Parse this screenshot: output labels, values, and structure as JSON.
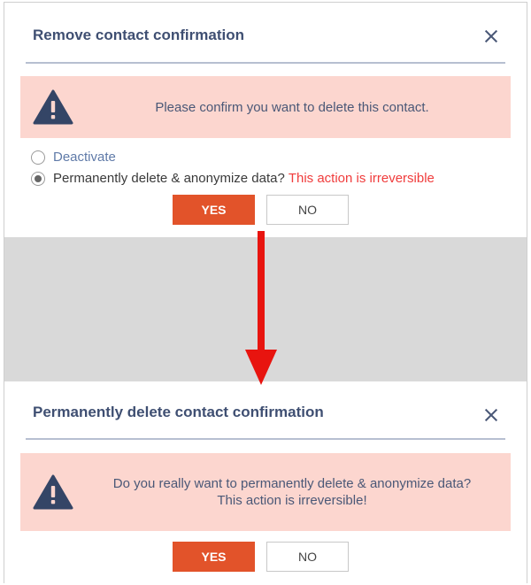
{
  "dialog1": {
    "title": "Remove contact confirmation",
    "message": "Please confirm you want to delete this contact.",
    "options": [
      {
        "label": "Deactivate",
        "checked": false
      },
      {
        "label": "Permanently delete & anonymize data?",
        "checked": true,
        "warning": "This action is irreversible"
      }
    ],
    "yes_label": "YES",
    "no_label": "NO"
  },
  "dialog2": {
    "title": "Permanently delete contact confirmation",
    "message_line1": "Do you really want to permanently delete & anonymize data?",
    "message_line2": "This action is irreversible!",
    "yes_label": "YES",
    "no_label": "NO"
  },
  "icons": {
    "close": "close-icon",
    "warning": "warning-triangle-icon",
    "arrow": "arrow-down-icon"
  },
  "colors": {
    "title": "#3f4f72",
    "alert_bg": "#fcd6cf",
    "primary_button": "#e2532a",
    "warning_text": "#f03c3c",
    "arrow": "#e8140f",
    "band": "#d9d9d9"
  }
}
